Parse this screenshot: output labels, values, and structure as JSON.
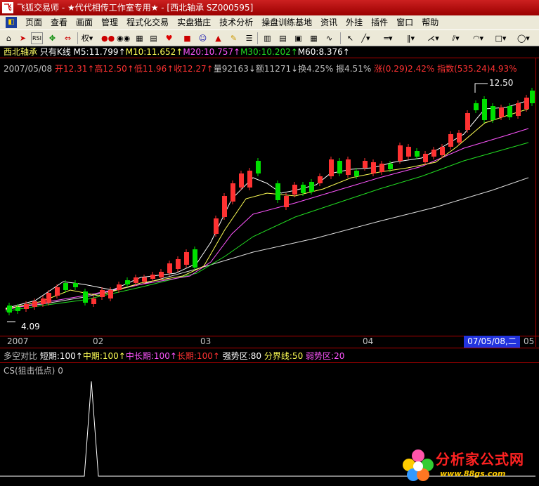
{
  "window": {
    "title": "飞狐交易师 - ★代代相传工作室专用★ - [西北轴承 SZ000595]"
  },
  "menu": {
    "items": [
      "页面",
      "查看",
      "画面",
      "管理",
      "程式化交易",
      "实盘猎庄",
      "技术分析",
      "操盘训练基地",
      "资讯",
      "外挂",
      "插件",
      "窗口",
      "帮助"
    ]
  },
  "toolbar": {
    "rights_label": "权"
  },
  "header": {
    "stock_name": "西北轴承",
    "mode": "只有K线",
    "ma5": "M5:11.799↑",
    "ma10": "M10:11.652↑",
    "ma20": "M20:10.757↑",
    "ma30": "M30:10.202↑",
    "ma60": "M60:8.376↑"
  },
  "info": {
    "date": "2007/05/08",
    "open": "开12.31↑",
    "high": "高12.50↑",
    "low": "低11.96↑",
    "close": "收12.27↑",
    "volume": "量92163↓",
    "amount": "额11271↓",
    "turnover": "换4.25%",
    "amplitude": "振4.51%",
    "change": "涨(0.29)2.42%",
    "index": "指数(535.24)4.93%"
  },
  "price_chart": {
    "high_label": "12.50",
    "low_label": "4.09",
    "colors": {
      "up": "#ff3232",
      "down": "#00e000",
      "ma5": "#ffffff",
      "ma10": "#ffff55",
      "ma20": "#ff55ff",
      "ma30": "#22dd22",
      "ma60": "#e0e0e0"
    }
  },
  "axis": {
    "ticks": [
      "2007",
      "02",
      "03",
      "04",
      "05"
    ],
    "cursor_label": "07/05/08,二"
  },
  "indicator": {
    "title": "多空对比",
    "short": "短期:100↑",
    "mid": "中期:100↑",
    "midlong": "中长期:100↑",
    "long": "长期:100↑",
    "strong": "强势区:80",
    "divider": "分界线:50",
    "weak": "弱势区:20"
  },
  "cs": {
    "title": "CS(狙击低点)",
    "value": "0"
  },
  "watermark": {
    "name": "分析家公式网",
    "url": "www.88gs.com"
  }
}
